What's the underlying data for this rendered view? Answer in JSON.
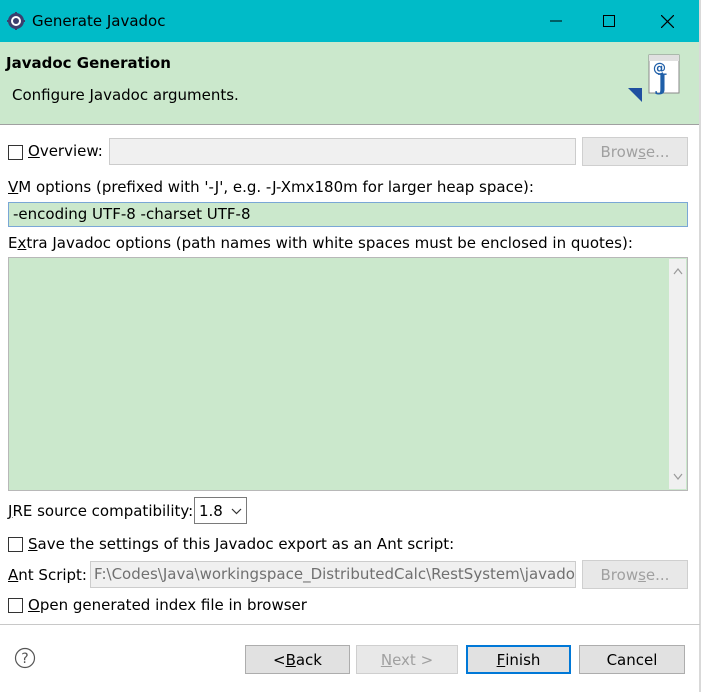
{
  "window": {
    "title": "Generate Javadoc"
  },
  "banner": {
    "title": "Javadoc Generation",
    "subtitle": "Configure Javadoc arguments.",
    "icon": "javadoc-icon"
  },
  "overview": {
    "label_pre": "",
    "label_ul": "O",
    "label_post": "verview:",
    "value": "",
    "browse": {
      "pre": "Brow",
      "ul": "s",
      "post": "e..."
    }
  },
  "vm_options": {
    "label_pre": "",
    "label_ul": "V",
    "label_post": "M options (prefixed with '-J', e.g. -J-Xmx180m for larger heap space):",
    "value": "-encoding UTF-8 -charset UTF-8"
  },
  "extra_options": {
    "label_pre": "E",
    "label_ul": "x",
    "label_post": "tra Javadoc options (path names with white spaces must be enclosed in quotes):",
    "value": ""
  },
  "jre": {
    "label_pre": "",
    "label_ul": "J",
    "label_post": "RE source compatibility:",
    "value": "1.8"
  },
  "save_ant": {
    "label_pre": "",
    "label_ul": "S",
    "label_post": "ave the settings of this Javadoc export as an Ant script:"
  },
  "ant_script": {
    "label_pre": "",
    "label_ul": "A",
    "label_post": "nt Script:",
    "value": "F:\\Codes\\Java\\workingspace_DistributedCalc\\RestSystem\\javadoc",
    "browse": {
      "pre": "Brow",
      "ul": "s",
      "post": "e..."
    }
  },
  "open_index": {
    "label_pre": "",
    "label_ul": "O",
    "label_post": "pen generated index file in browser"
  },
  "buttons": {
    "back": {
      "pre": "< ",
      "ul": "B",
      "post": "ack"
    },
    "next": {
      "pre": "",
      "ul": "N",
      "post": "ext >"
    },
    "finish": {
      "pre": "",
      "ul": "F",
      "post": "inish"
    },
    "cancel": {
      "pre": "Cancel",
      "ul": "",
      "post": ""
    }
  },
  "colors": {
    "titlebar": "#00bbc8",
    "banner": "#cbe8cc",
    "field_green": "#cbe8cc",
    "focus": "#0078d7"
  }
}
